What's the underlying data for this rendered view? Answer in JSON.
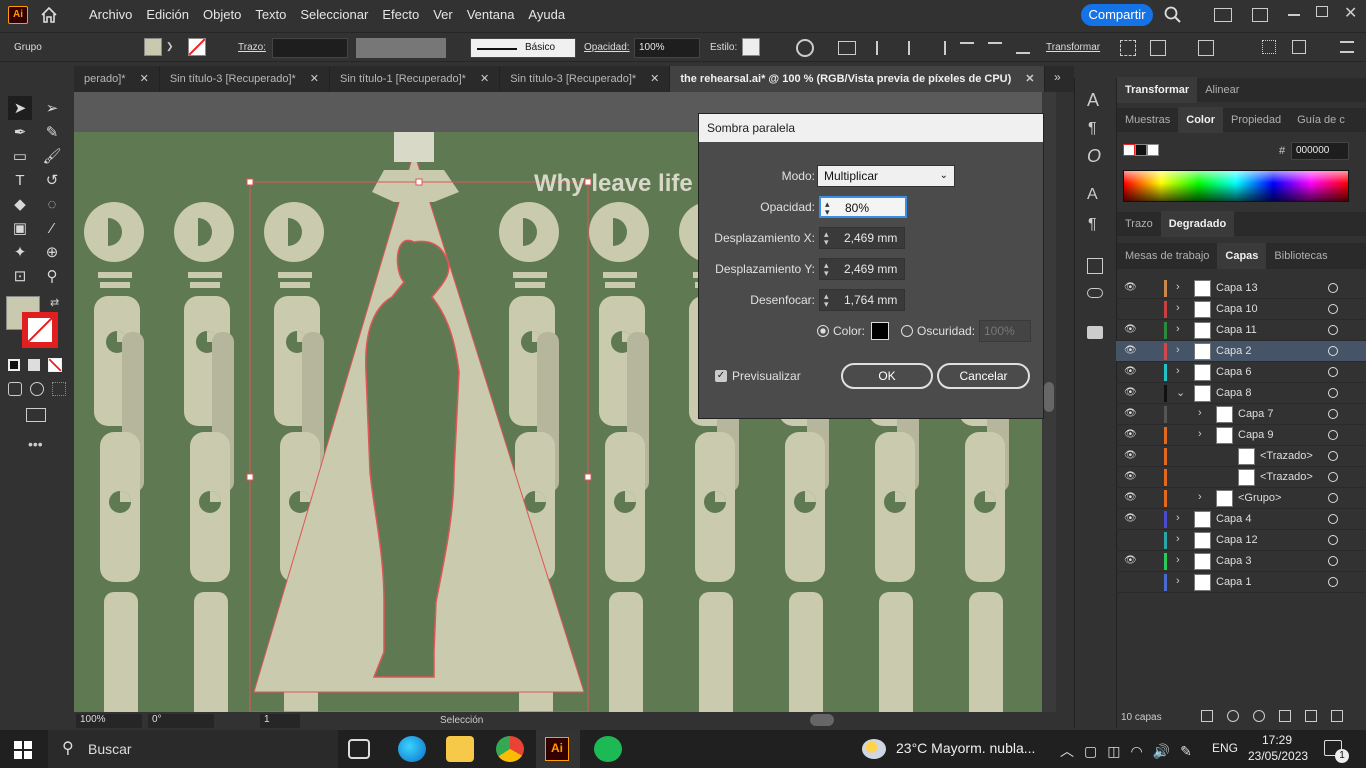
{
  "menubar": {
    "app_logo": "Ai",
    "items": [
      "Archivo",
      "Edición",
      "Objeto",
      "Texto",
      "Seleccionar",
      "Efecto",
      "Ver",
      "Ventana",
      "Ayuda"
    ],
    "share_label": "Compartir"
  },
  "control_bar": {
    "group_label": "Grupo",
    "stroke_label": "Trazo:",
    "brush_label": "Básico",
    "opacity_label": "Opacidad:",
    "opacity_value": "100%",
    "style_label": "Estilo:",
    "transform_label": "Transformar"
  },
  "tabs": [
    {
      "label": "perado]*",
      "active": false
    },
    {
      "label": "Sin título-3 [Recuperado]*",
      "active": false
    },
    {
      "label": "Sin título-1 [Recuperado]*",
      "active": false
    },
    {
      "label": "Sin título-3 [Recuperado]*",
      "active": false
    },
    {
      "label": "the rehearsal.ai* @ 100 % (RGB/Vista previa de píxeles de CPU)",
      "active": true
    }
  ],
  "canvas": {
    "headline": "Why leave life"
  },
  "dialog": {
    "title": "Sombra paralela",
    "mode_label": "Modo:",
    "mode_value": "Multiplicar",
    "opacity_label": "Opacidad:",
    "opacity_value": "80%",
    "offset_x_label": "Desplazamiento X:",
    "offset_x_value": "2,469 mm",
    "offset_y_label": "Desplazamiento Y:",
    "offset_y_value": "2,469 mm",
    "blur_label": "Desenfocar:",
    "blur_value": "1,764 mm",
    "color_label": "Color:",
    "color_value": "#000000",
    "darkness_label": "Oscuridad:",
    "darkness_value": "100%",
    "preview_label": "Previsualizar",
    "preview_checked": true,
    "ok_label": "OK",
    "cancel_label": "Cancelar"
  },
  "right_panel": {
    "transform_tab": "Transformar",
    "align_tab": "Alinear",
    "swatches_tab": "Muestras",
    "color_tab": "Color",
    "props_tab": "Propiedad",
    "guide_tab": "Guía de c",
    "hex_label": "#",
    "hex_value": "000000",
    "stroke_tab": "Trazo",
    "gradient_tab": "Degradado",
    "artboards_tab": "Mesas de trabajo",
    "layers_tab": "Capas",
    "libraries_tab": "Bibliotecas",
    "layers_count": "10 capas"
  },
  "layers": [
    {
      "name": "Capa 13",
      "visible": true,
      "color": "#c88a4a",
      "indent": 0,
      "expanded": false
    },
    {
      "name": "Capa 10",
      "visible": false,
      "color": "#c94040",
      "indent": 0,
      "expanded": false
    },
    {
      "name": "Capa 11",
      "visible": true,
      "color": "#2b8a3e",
      "indent": 0,
      "expanded": false
    },
    {
      "name": "Capa 2",
      "visible": true,
      "color": "#d04848",
      "indent": 0,
      "expanded": false,
      "selected": true
    },
    {
      "name": "Capa 6",
      "visible": true,
      "color": "#22c3c8",
      "indent": 0,
      "expanded": false
    },
    {
      "name": "Capa 8",
      "visible": true,
      "color": "#111111",
      "indent": 0,
      "expanded": true
    },
    {
      "name": "Capa 7",
      "visible": true,
      "color": "#555555",
      "indent": 1,
      "expanded": false
    },
    {
      "name": "Capa 9",
      "visible": true,
      "color": "#e06a20",
      "indent": 1,
      "expanded": false
    },
    {
      "name": "<Trazado>",
      "visible": true,
      "color": "#e06a20",
      "indent": 2,
      "expanded": false
    },
    {
      "name": "<Trazado>",
      "visible": true,
      "color": "#e06a20",
      "indent": 2,
      "expanded": false
    },
    {
      "name": "<Grupo>",
      "visible": true,
      "color": "#e06a20",
      "indent": 1,
      "expanded": false
    },
    {
      "name": "Capa 4",
      "visible": true,
      "color": "#4a4ad0",
      "indent": 0,
      "expanded": false
    },
    {
      "name": "Capa 12",
      "visible": false,
      "color": "#2aa6a6",
      "indent": 0,
      "expanded": false
    },
    {
      "name": "Capa 3",
      "visible": true,
      "color": "#2bc85a",
      "indent": 0,
      "expanded": false
    },
    {
      "name": "Capa 1",
      "visible": false,
      "color": "#4a6ad0",
      "indent": 0,
      "expanded": false
    }
  ],
  "status_bar": {
    "zoom": "100%",
    "rotation": "0°",
    "artboard": "1",
    "tool": "Selección"
  },
  "taskbar": {
    "search_placeholder": "Buscar",
    "weather": "23°C  Mayorm. nubla...",
    "language": "ENG",
    "time": "17:29",
    "date": "23/05/2023",
    "notifications": "1"
  }
}
